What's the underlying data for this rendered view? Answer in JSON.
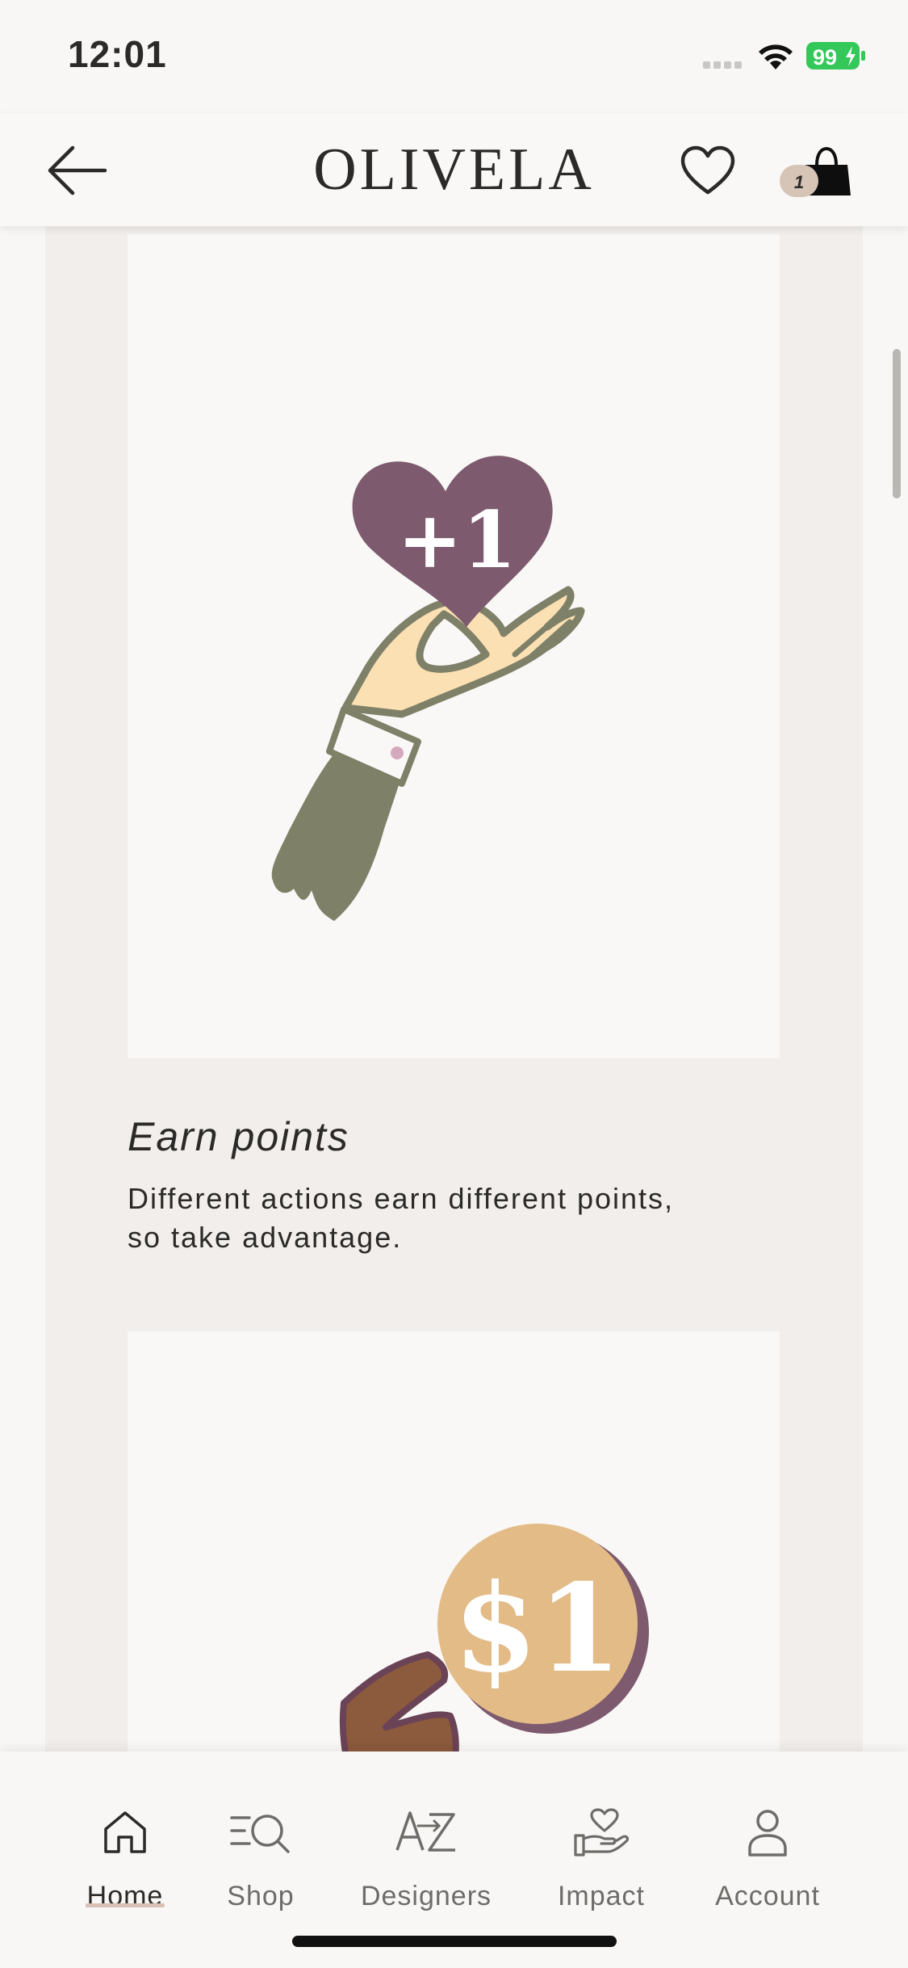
{
  "status_bar": {
    "time": "12:01",
    "battery": "99"
  },
  "header": {
    "brand": "OLIVELA",
    "bag_count": "1"
  },
  "cards": [
    {
      "badge_text": "+1",
      "title": "Earn points",
      "description": "Different actions earn different points, so take advantage."
    },
    {
      "badge_text": "$1"
    }
  ],
  "bottom_nav": {
    "items": [
      {
        "label": "Home",
        "icon": "home-icon",
        "active": true
      },
      {
        "label": "Shop",
        "icon": "shop-search-icon",
        "active": false
      },
      {
        "label": "Designers",
        "icon": "a-z-icon",
        "active": false
      },
      {
        "label": "Impact",
        "icon": "heart-hand-icon",
        "active": false
      },
      {
        "label": "Account",
        "icon": "person-icon",
        "active": false
      }
    ]
  },
  "colors": {
    "background": "#f8f7f5",
    "panel": "#f1eeeb",
    "heart": "#7d5a6d",
    "sleeve": "#7f8068",
    "coin": "#e2bb87",
    "active_underline": "#d8c0b2"
  }
}
